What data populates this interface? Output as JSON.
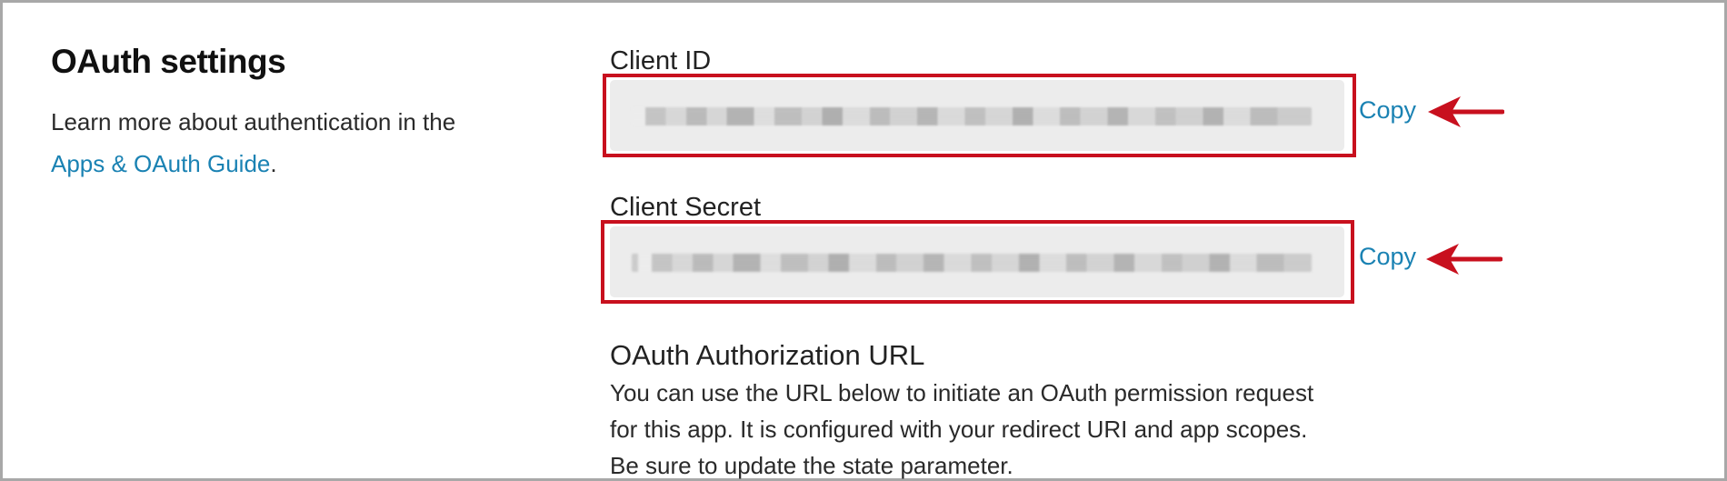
{
  "oauth_section": {
    "title": "OAuth settings",
    "desc_prefix": "Learn more about authentication in the ",
    "guide_link": "Apps & OAuth Guide",
    "desc_suffix": "."
  },
  "client_id": {
    "label": "Client ID",
    "value_state": "redacted (pixelated)",
    "copy_label": "Copy"
  },
  "client_secret": {
    "label": "Client Secret",
    "value_state": "redacted (pixelated)",
    "copy_label": "Copy"
  },
  "auth_url": {
    "heading": "OAuth Authorization URL",
    "line1": "You can use the URL below to initiate an OAuth permission request",
    "line2": "for this app. It is configured with your redirect URI and app scopes.",
    "line3": "Be sure to update the state parameter."
  },
  "colors": {
    "highlight_red": "#c8101e",
    "link_blue": "#1a82b3",
    "box_gray": "#ececec",
    "frame_gray": "#a8a8a8"
  },
  "icons": {
    "arrow": "left-arrow-icon"
  }
}
